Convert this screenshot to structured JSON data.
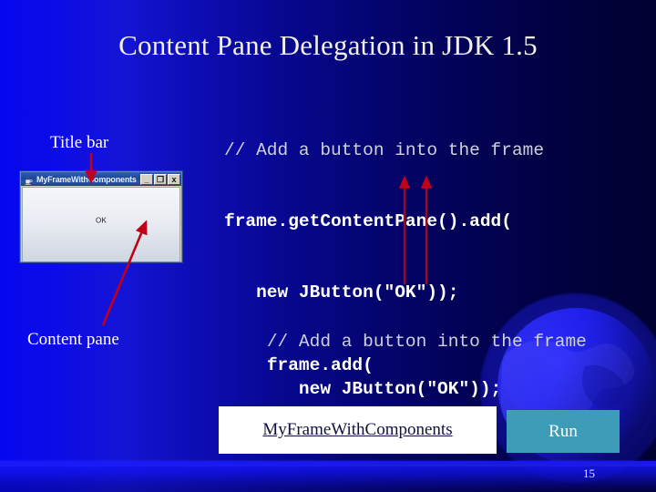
{
  "slide": {
    "title": "Content Pane Delegation in JDK 1.5",
    "page_number": "15",
    "accent_colors": {
      "background_left": "#0707ef",
      "background_right": "#010132",
      "annotation_red": "#c00018",
      "run_button_teal": "#3d9cb8",
      "link_navy": "#101244",
      "title_cream": "#f2f0e6"
    }
  },
  "labels": {
    "title_bar": "Title bar",
    "content_pane": "Content pane"
  },
  "code_top": {
    "comment": "// Add a button into the frame",
    "line2": "frame.getContentPane().add(",
    "line3": "   new JButton(\"OK\"));"
  },
  "code_bottom": {
    "comment": "// Add a button into the frame",
    "line2": "frame.add(",
    "line3": "   new JButton(\"OK\"));"
  },
  "mini_window": {
    "title": "MyFrameWithComponents",
    "app_icon": "java-coffee-cup-icon",
    "buttons": {
      "minimize": "_",
      "maximize": "❐",
      "close": "x"
    },
    "ok_button_label": "OK"
  },
  "link": {
    "label": "MyFrameWithComponents"
  },
  "run": {
    "label": "Run"
  },
  "annotations": {
    "arrow_to_titlebar": "red-arrow-up-icon",
    "arrow_to_contentpane": "red-arrow-up-icon",
    "arrow_code_left": "red-arrow-up-icon",
    "arrow_code_right": "red-arrow-up-icon"
  }
}
